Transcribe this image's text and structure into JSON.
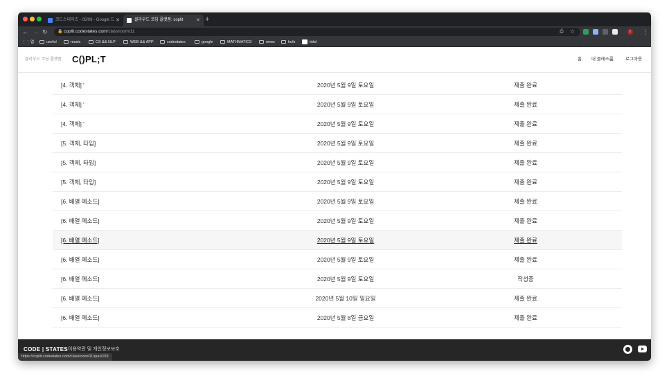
{
  "browser": {
    "tabs": [
      {
        "title": "코드스테이츠 - 05/09 - Google 드",
        "favicon_color": "#4285f4",
        "active": false
      },
      {
        "title": "클라우드 코딩 플랫폼: coplit",
        "favicon_color": "#ffffff",
        "active": true
      }
    ],
    "url": {
      "host": "coplit.codestates.com",
      "path": "/classroom/11"
    },
    "bookmarks": [
      "앱",
      "useful",
      "music",
      "CS && NLP",
      "WEB && APP",
      "codestates",
      "google",
      "MATHMATICS",
      "news",
      "hufs",
      "tidal"
    ],
    "profile_initial": "I"
  },
  "site": {
    "brand_sub": "클라우드 코딩 플랫폼",
    "brand": "C()PL;T",
    "nav": [
      "홈",
      "내 클래스룸",
      "로그아웃"
    ]
  },
  "rows": [
    {
      "title": "[4. 객체] '",
      "date": "2020년 5월 9일 토요일",
      "status": "제출 완료"
    },
    {
      "title": "[4. 객체] '",
      "date": "2020년 5월 9일 토요일",
      "status": "제출 완료"
    },
    {
      "title": "[4. 객체] '",
      "date": "2020년 5월 9일 토요일",
      "status": "제출 완료"
    },
    {
      "title": "[5. 객체, 타입]",
      "date": "2020년 5월 9일 토요일",
      "status": "제출 완료"
    },
    {
      "title": "[5. 객체, 타입]",
      "date": "2020년 5월 9일 토요일",
      "status": "제출 완료"
    },
    {
      "title": "[5. 객체, 타입]",
      "date": "2020년 5월 9일 토요일",
      "status": "제출 완료"
    },
    {
      "title": "[6. 배열 메소드]",
      "date": "2020년 5월 9일 토요일",
      "status": "제출 완료"
    },
    {
      "title": "[6. 배열 메소드]",
      "date": "2020년 5월 9일 토요일",
      "status": "제출 완료"
    },
    {
      "title": "[6. 배열 메소드]",
      "date": "2020년 5월 9일 토요일",
      "status": "제출 완료",
      "hover": true
    },
    {
      "title": "[6. 배열 메소드]",
      "date": "2020년 5월 9일 토요일",
      "status": "제출 완료"
    },
    {
      "title": "[6. 배열 메소드]",
      "date": "2020년 5월 9일 토요일",
      "status": "작성중"
    },
    {
      "title": "[6. 배열 메소드]",
      "date": "2020년 5월 10일 일요일",
      "status": "제출 완료"
    },
    {
      "title": "[6. 배열 메소드]",
      "date": "2020년 5월 8일 금요일",
      "status": "제출 완료"
    }
  ],
  "footer": {
    "logo": "CODE | STATES",
    "terms": "이용약관 및 개인정보보호"
  },
  "status_url": "https://coplit.codestates.com/classroom/11/quiz/159",
  "colors": {
    "chrome_dark": "#202124",
    "chrome_toolbar": "#35363a",
    "footer": "#262626"
  }
}
